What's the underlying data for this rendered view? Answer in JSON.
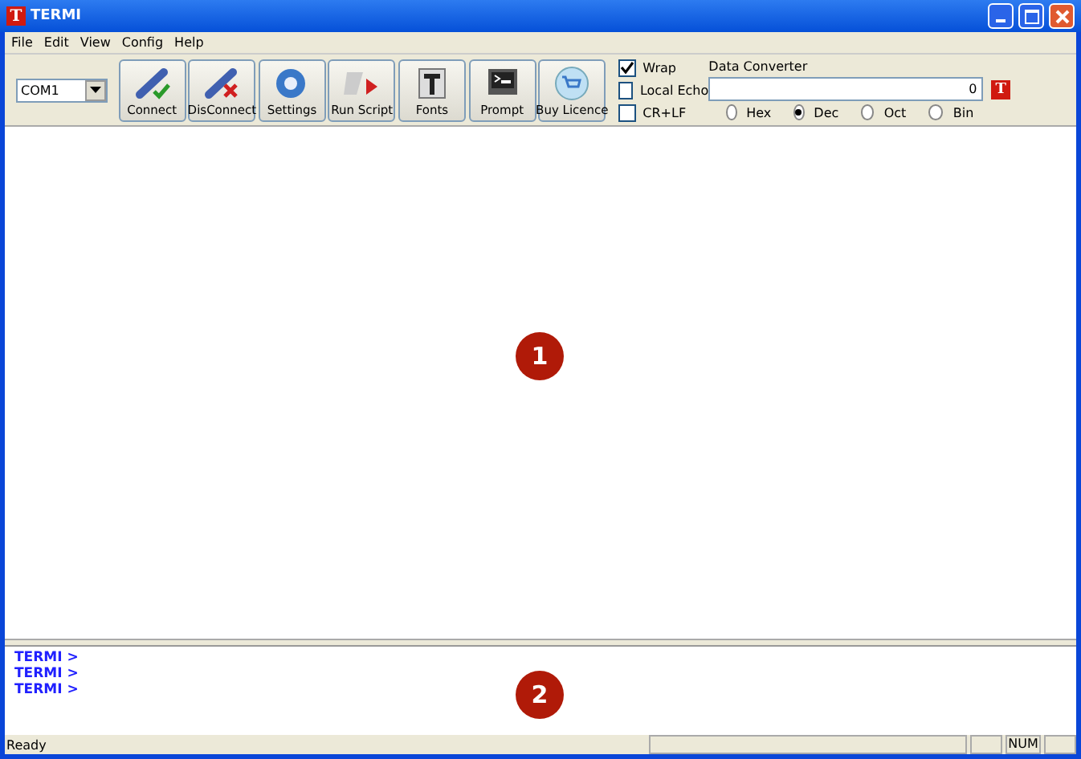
{
  "window": {
    "title": "TERMI",
    "icon_letter": "T"
  },
  "menu": [
    "File",
    "Edit",
    "View",
    "Config",
    "Help"
  ],
  "port": {
    "value": "COM1"
  },
  "toolbar": [
    {
      "label": "Connect",
      "kind": "connect"
    },
    {
      "label": "DisConnect",
      "kind": "disconnect"
    },
    {
      "label": "Settings",
      "kind": "settings"
    },
    {
      "label": "Run Script",
      "kind": "script"
    },
    {
      "label": "Fonts",
      "kind": "fonts"
    },
    {
      "label": "Prompt",
      "kind": "prompt"
    },
    {
      "label": "Buy Licence",
      "kind": "cart"
    }
  ],
  "options": [
    {
      "label": "Wrap",
      "checked": true
    },
    {
      "label": "Local Echo",
      "checked": false
    },
    {
      "label": "CR+LF",
      "checked": false
    }
  ],
  "data_converter": {
    "label": "Data Converter",
    "value": "0",
    "button": "T",
    "radios": [
      {
        "label": "Hex",
        "selected": false
      },
      {
        "label": "Dec",
        "selected": true
      },
      {
        "label": "Oct",
        "selected": false
      },
      {
        "label": "Bin",
        "selected": false
      }
    ]
  },
  "output": {
    "callout": "1"
  },
  "input": {
    "lines": [
      "TERMI >",
      "TERMI >",
      "TERMI >"
    ],
    "callout": "2"
  },
  "status_bar": {
    "text": "Ready",
    "num": "NUM"
  }
}
